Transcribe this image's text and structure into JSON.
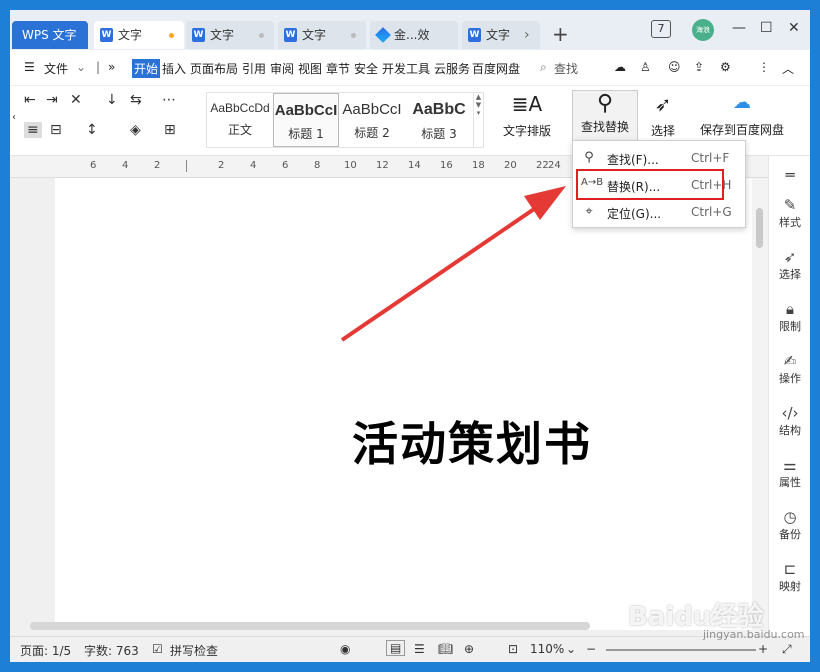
{
  "titlebar": {
    "app_tab": "WPS 文字",
    "tabs": [
      {
        "label": "文字"
      },
      {
        "label": "文字"
      },
      {
        "label": "文字"
      },
      {
        "label": "金...效"
      },
      {
        "label": "文字"
      }
    ],
    "window_count": "7",
    "avatar_text": "海浪"
  },
  "menubar": {
    "file": "文件",
    "items": [
      "开始",
      "插入",
      "页面布局",
      "引用",
      "审阅",
      "视图",
      "章节",
      "安全",
      "开发工具",
      "云服务",
      "百度网盘"
    ],
    "search": "查找"
  },
  "ribbon": {
    "styles": [
      {
        "sample": "AaBbCcDd",
        "name": "正文"
      },
      {
        "sample": "AaBbCcI",
        "name": "标题 1"
      },
      {
        "sample": "AaBbCcI",
        "name": "标题 2"
      },
      {
        "sample": "AaBbC",
        "name": "标题 3"
      }
    ],
    "text_layout": "文字排版",
    "find_replace": "查找替换",
    "select": "选择",
    "save_baidu": "保存到百度网盘"
  },
  "dropdown": {
    "items": [
      {
        "label": "查找(F)...",
        "shortcut": "Ctrl+F"
      },
      {
        "label": "替换(R)...",
        "shortcut": "Ctrl+H"
      },
      {
        "label": "定位(G)...",
        "shortcut": "Ctrl+G"
      }
    ]
  },
  "ruler": {
    "numbers": [
      "6",
      "4",
      "2",
      "2",
      "4",
      "6",
      "8",
      "10",
      "12",
      "14",
      "16",
      "18",
      "20",
      "22",
      "24"
    ]
  },
  "document": {
    "title": "活动策划书"
  },
  "right_panel": {
    "items": [
      "样式",
      "选择",
      "限制",
      "操作",
      "结构",
      "属性",
      "备份",
      "映射"
    ]
  },
  "statusbar": {
    "page": "页面: 1/5",
    "words": "字数: 763",
    "spellcheck": "拼写检查",
    "zoom": "110%"
  },
  "watermark": {
    "text": "Baidu经验",
    "sub": "jingyan.baidu.com"
  },
  "colors": {
    "accent": "#2b72d7",
    "highlight_red": "#e02020",
    "arrow_red": "#e53935"
  }
}
